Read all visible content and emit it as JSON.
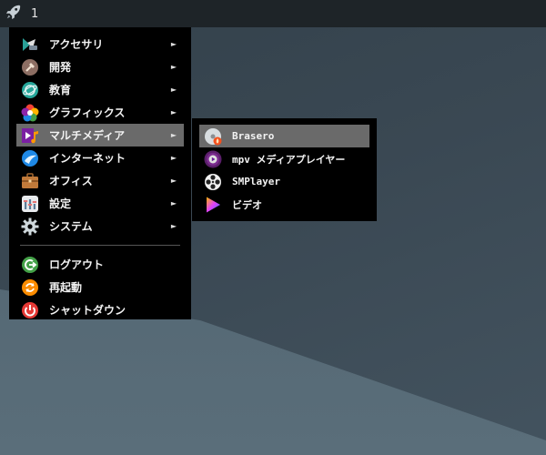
{
  "taskbar": {
    "launcher_icon": "rocket-icon",
    "workspace_label": "1"
  },
  "menu": {
    "items": [
      {
        "label": "アクセサリ",
        "icon": "accessories-icon",
        "has_submenu": true
      },
      {
        "label": "開発",
        "icon": "development-icon",
        "has_submenu": true
      },
      {
        "label": "教育",
        "icon": "education-icon",
        "has_submenu": true
      },
      {
        "label": "グラフィックス",
        "icon": "graphics-icon",
        "has_submenu": true
      },
      {
        "label": "マルチメディア",
        "icon": "multimedia-icon",
        "has_submenu": true,
        "active": true
      },
      {
        "label": "インターネット",
        "icon": "internet-icon",
        "has_submenu": true
      },
      {
        "label": "オフィス",
        "icon": "office-icon",
        "has_submenu": true
      },
      {
        "label": "設定",
        "icon": "settings-icon",
        "has_submenu": true
      },
      {
        "label": "システム",
        "icon": "system-icon",
        "has_submenu": true
      }
    ],
    "session_items": [
      {
        "label": "ログアウト",
        "icon": "logout-icon"
      },
      {
        "label": "再起動",
        "icon": "reboot-icon"
      },
      {
        "label": "シャットダウン",
        "icon": "shutdown-icon"
      }
    ],
    "arrow_glyph": "►"
  },
  "submenu": {
    "items": [
      {
        "label": "Brasero",
        "icon": "brasero-icon",
        "active": true
      },
      {
        "label": "mpv メディアプレイヤー",
        "icon": "mpv-icon"
      },
      {
        "label": "SMPlayer",
        "icon": "smplayer-icon"
      },
      {
        "label": "ビデオ",
        "icon": "video-icon"
      }
    ]
  },
  "colors": {
    "menu_bg": "#000000",
    "highlight": "#6a6a6a",
    "taskbar_bg": "#1e2428",
    "desktop": "#3b4a55"
  }
}
